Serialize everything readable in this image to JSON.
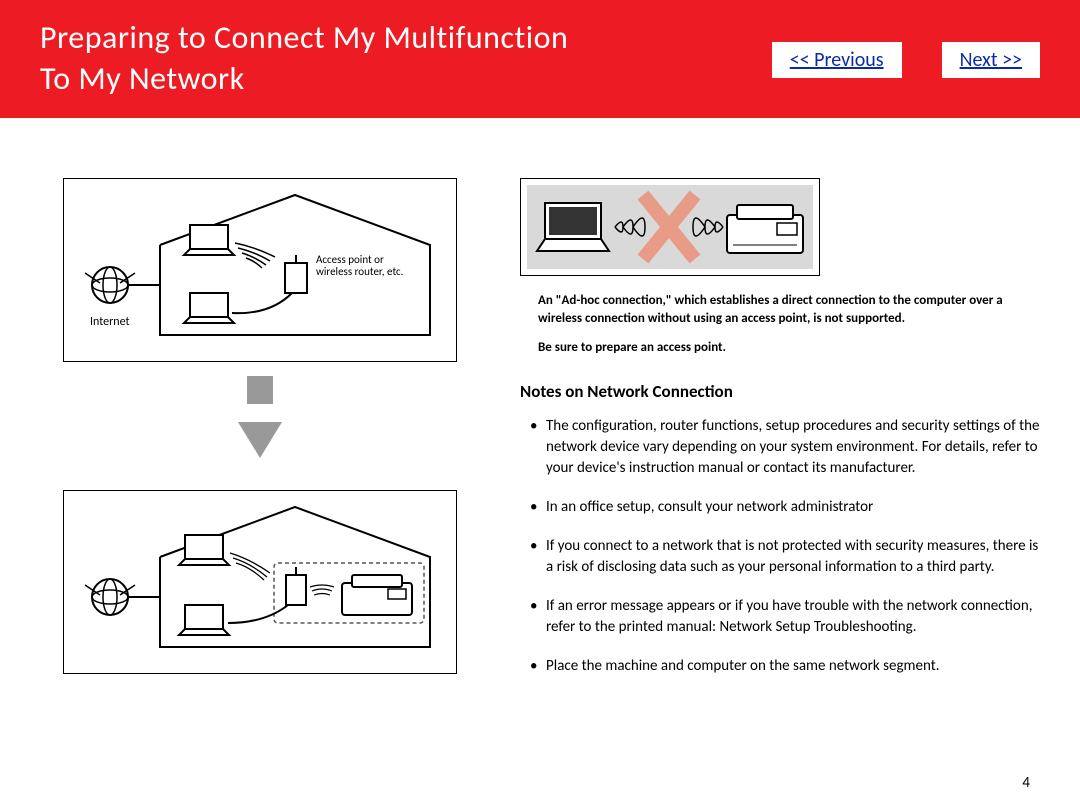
{
  "header": {
    "title_line1": "Preparing to Connect My Multifunction",
    "title_line2": "To My Network",
    "prev_label": "<< Previous",
    "next_label": "Next >>"
  },
  "diagrams": {
    "top": {
      "internet_label": "Internet",
      "ap_label": "Access point or\nwireless router, etc."
    }
  },
  "adhoc": {
    "line1": "An \"Ad-hoc connection,\" which establishes a direct connection to the computer over a wireless connection without using an access point, is not supported.",
    "line2": "Be sure to prepare an access point."
  },
  "notes": {
    "heading": "Notes on Network Connection",
    "items": [
      "The configuration, router functions, setup procedures and security settings of the network device vary depending on your system environment. For details, refer to your device's instruction manual or contact its manufacturer.",
      "In an office setup, consult your network administrator",
      "If you connect to a network that is not protected with security measures, there is a risk of disclosing data such as your personal information to a third party.",
      "If an error message appears or if you have trouble with the network connection, refer to the printed manual: Network Setup Troubleshooting.",
      "Place the machine and computer on the same network segment."
    ]
  },
  "page_number": "4"
}
